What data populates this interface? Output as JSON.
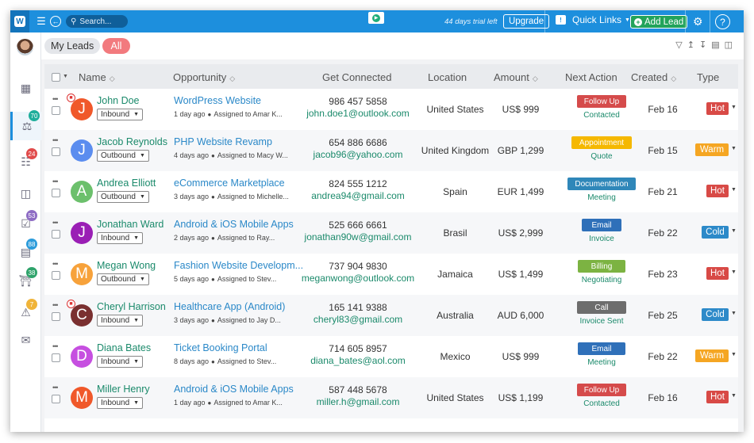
{
  "colors": {
    "brand": "#1d8fdd",
    "hot": "#d84a46",
    "warm": "#f5a623",
    "cold": "#2d8ac9",
    "green": "#1b8a6b"
  },
  "topbar": {
    "search_placeholder": "Search...",
    "trial_text": "44 days trial left",
    "upgrade_label": "Upgrade",
    "quick_links_label": "Quick Links",
    "add_lead_label": "Add Lead",
    "help_label": "?"
  },
  "sidebar": {
    "items": [
      {
        "icon": "dashboard-icon",
        "badge": ""
      },
      {
        "icon": "leads-icon",
        "badge": "70",
        "badge_color": "#1fae9b"
      },
      {
        "icon": "contacts-icon",
        "badge": "24",
        "badge_color": "#e14b4b"
      },
      {
        "icon": "pipeline-icon",
        "badge": ""
      },
      {
        "icon": "tasks-icon",
        "badge": "53",
        "badge_color": "#8e6cc4"
      },
      {
        "icon": "calendar-icon",
        "badge": "88",
        "badge_color": "#2d9cdb"
      },
      {
        "icon": "bank-icon",
        "badge": "38",
        "badge_color": "#2fa36b"
      },
      {
        "icon": "alerts-icon",
        "badge": "7",
        "badge_color": "#f0b43a"
      },
      {
        "icon": "mail-icon",
        "badge": ""
      }
    ]
  },
  "subheader": {
    "my_leads": "My Leads",
    "all": "All"
  },
  "table": {
    "headers": {
      "name": "Name",
      "opportunity": "Opportunity",
      "get_connected": "Get Connected",
      "location": "Location",
      "amount": "Amount",
      "next_action": "Next Action",
      "created": "Created",
      "type": "Type"
    },
    "rows": [
      {
        "initial": "J",
        "avatar_color": "#f0582a",
        "fav": true,
        "name": "John Doe",
        "source": "Inbound",
        "opp": "WordPress Website",
        "opp_meta_time": "1 day ago",
        "opp_meta_assign": "Assigned to Amar K...",
        "phone": "986 457 5858",
        "email": "john.doe1@outlook.com",
        "location": "United States",
        "amount": "US$ 999",
        "action": "Follow Up",
        "action_color": "#d54b4b",
        "action_sub": "Contacted",
        "created": "Feb 16",
        "type": "Hot",
        "type_color": "#d84a46"
      },
      {
        "initial": "J",
        "avatar_color": "#5b8def",
        "fav": false,
        "name": "Jacob Reynolds",
        "source": "Outbound",
        "opp": "PHP Website Revamp",
        "opp_meta_time": "4 days ago",
        "opp_meta_assign": "Assigned to Macy W...",
        "phone": "654 886 6686",
        "email": "jacob96@yahoo.com",
        "location": "United Kingdom",
        "amount": "GBP 1,299",
        "action": "Appointment",
        "action_color": "#f5b800",
        "action_sub": "Quote",
        "created": "Feb 15",
        "type": "Warm",
        "type_color": "#f5a623"
      },
      {
        "initial": "A",
        "avatar_color": "#6cc06c",
        "fav": false,
        "name": "Andrea Elliott",
        "source": "Outbound",
        "opp": "eCommerce Marketplace",
        "opp_meta_time": "3 days ago",
        "opp_meta_assign": "Assigned to Michelle...",
        "phone": "824 555 1212",
        "email": "andrea94@gmail.com",
        "location": "Spain",
        "amount": "EUR 1,499",
        "action": "Documentation",
        "action_color": "#2f87b9",
        "action_sub": "Meeting",
        "created": "Feb 21",
        "type": "Hot",
        "type_color": "#d84a46"
      },
      {
        "initial": "J",
        "avatar_color": "#9a1fb5",
        "fav": false,
        "name": "Jonathan Ward",
        "source": "Inbound",
        "opp": "Android & iOS Mobile Apps",
        "opp_meta_time": "2 days ago",
        "opp_meta_assign": "Assigned to Ray...",
        "phone": "525 666 6661",
        "email": "jonathan90w@gmail.com",
        "location": "Brasil",
        "amount": "US$ 2,999",
        "action": "Email",
        "action_color": "#2f70b9",
        "action_sub": "Invoice",
        "created": "Feb 22",
        "type": "Cold",
        "type_color": "#2d8ac9"
      },
      {
        "initial": "M",
        "avatar_color": "#f7a23b",
        "fav": false,
        "name": "Megan Wong",
        "source": "Outbound",
        "opp": "Fashion Website Developm...",
        "opp_meta_time": "5 days ago",
        "opp_meta_assign": "Assigned to Stev...",
        "phone": "737 904 9830",
        "email": "meganwong@outlook.com",
        "location": "Jamaica",
        "amount": "US$ 1,499",
        "action": "Billing",
        "action_color": "#7cb342",
        "action_sub": "Negotiating",
        "created": "Feb 23",
        "type": "Hot",
        "type_color": "#d84a46"
      },
      {
        "initial": "C",
        "avatar_color": "#7a3030",
        "fav": true,
        "name": "Cheryl Harrison",
        "source": "Inbound",
        "opp": "Healthcare App (Android)",
        "opp_meta_time": "3 days ago",
        "opp_meta_assign": "Assigned to Jay D...",
        "phone": "165 141 9388",
        "email": "cheryl83@gmail.com",
        "location": "Australia",
        "amount": "AUD 6,000",
        "action": "Call",
        "action_color": "#6d6d6d",
        "action_sub": "Invoice Sent",
        "created": "Feb 25",
        "type": "Cold",
        "type_color": "#2d8ac9"
      },
      {
        "initial": "D",
        "avatar_color": "#c64fe0",
        "fav": false,
        "name": "Diana Bates",
        "source": "Inbound",
        "opp": "Ticket Booking Portal",
        "opp_meta_time": "8 days ago",
        "opp_meta_assign": "Assigned to Stev...",
        "phone": "714 605 8957",
        "email": "diana_bates@aol.com",
        "location": "Mexico",
        "amount": "US$ 999",
        "action": "Email",
        "action_color": "#2f70b9",
        "action_sub": "Meeting",
        "created": "Feb 22",
        "type": "Warm",
        "type_color": "#f5a623"
      },
      {
        "initial": "M",
        "avatar_color": "#f0582a",
        "fav": false,
        "name": "Miller Henry",
        "source": "Inbound",
        "opp": "Android & iOS Mobile Apps",
        "opp_meta_time": "1 day ago",
        "opp_meta_assign": "Assigned to Amar K...",
        "phone": "587 448 5678",
        "email": "miller.h@gmail.com",
        "location": "United States",
        "amount": "US$ 1,199",
        "action": "Follow Up",
        "action_color": "#d54b4b",
        "action_sub": "Contacted",
        "created": "Feb 16",
        "type": "Hot",
        "type_color": "#d84a46"
      }
    ]
  }
}
